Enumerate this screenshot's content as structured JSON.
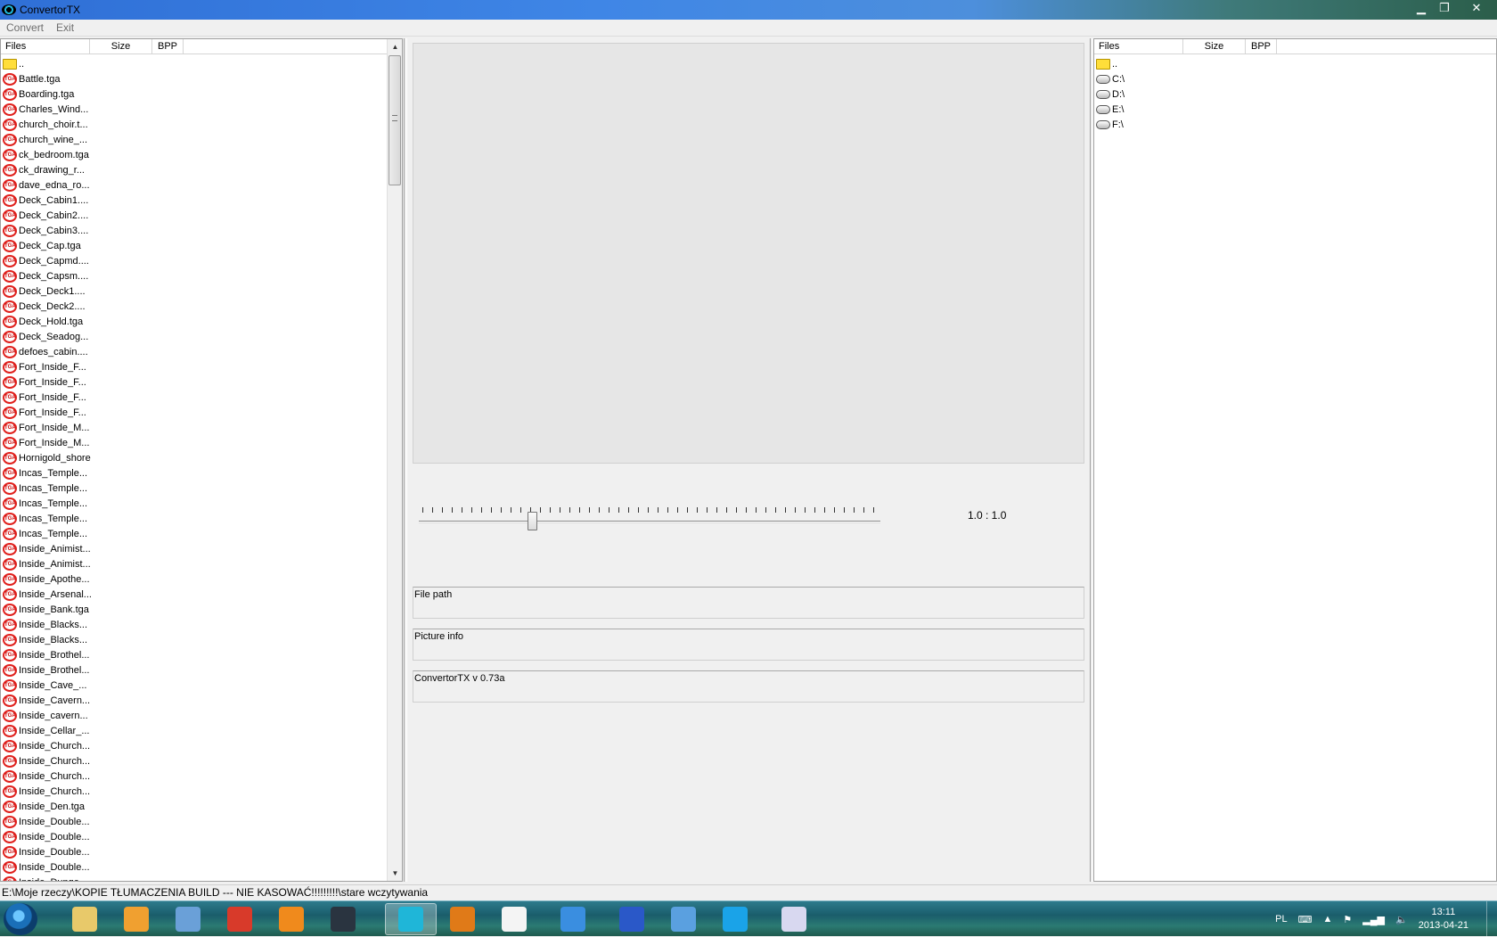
{
  "window": {
    "title": "ConvertorTX",
    "minimize": "▁",
    "restore": "❐",
    "close": "✕"
  },
  "menu": [
    {
      "label": "Convert"
    },
    {
      "label": "Exit"
    }
  ],
  "left_panel": {
    "columns": {
      "files": "Files",
      "size": "Size",
      "bpp": "BPP"
    },
    "items": [
      {
        "name": "..",
        "type": "folder"
      },
      {
        "name": "Battle.tga",
        "type": "tga"
      },
      {
        "name": "Boarding.tga",
        "type": "tga"
      },
      {
        "name": "Charles_Wind...",
        "type": "tga"
      },
      {
        "name": "church_choir.t...",
        "type": "tga"
      },
      {
        "name": "church_wine_...",
        "type": "tga"
      },
      {
        "name": "ck_bedroom.tga",
        "type": "tga"
      },
      {
        "name": "ck_drawing_r...",
        "type": "tga"
      },
      {
        "name": "dave_edna_ro...",
        "type": "tga"
      },
      {
        "name": "Deck_Cabin1....",
        "type": "tga"
      },
      {
        "name": "Deck_Cabin2....",
        "type": "tga"
      },
      {
        "name": "Deck_Cabin3....",
        "type": "tga"
      },
      {
        "name": "Deck_Cap.tga",
        "type": "tga"
      },
      {
        "name": "Deck_Capmd....",
        "type": "tga"
      },
      {
        "name": "Deck_Capsm....",
        "type": "tga"
      },
      {
        "name": "Deck_Deck1....",
        "type": "tga"
      },
      {
        "name": "Deck_Deck2....",
        "type": "tga"
      },
      {
        "name": "Deck_Hold.tga",
        "type": "tga"
      },
      {
        "name": "Deck_Seadog...",
        "type": "tga"
      },
      {
        "name": "defoes_cabin....",
        "type": "tga"
      },
      {
        "name": "Fort_Inside_F...",
        "type": "tga"
      },
      {
        "name": "Fort_Inside_F...",
        "type": "tga"
      },
      {
        "name": "Fort_Inside_F...",
        "type": "tga"
      },
      {
        "name": "Fort_Inside_F...",
        "type": "tga"
      },
      {
        "name": "Fort_Inside_M...",
        "type": "tga"
      },
      {
        "name": "Fort_Inside_M...",
        "type": "tga"
      },
      {
        "name": "Hornigold_shore",
        "type": "tga"
      },
      {
        "name": "Incas_Temple...",
        "type": "tga"
      },
      {
        "name": "Incas_Temple...",
        "type": "tga"
      },
      {
        "name": "Incas_Temple...",
        "type": "tga"
      },
      {
        "name": "Incas_Temple...",
        "type": "tga"
      },
      {
        "name": "Incas_Temple...",
        "type": "tga"
      },
      {
        "name": "Inside_Animist...",
        "type": "tga"
      },
      {
        "name": "Inside_Animist...",
        "type": "tga"
      },
      {
        "name": "Inside_Apothe...",
        "type": "tga"
      },
      {
        "name": "Inside_Arsenal...",
        "type": "tga"
      },
      {
        "name": "Inside_Bank.tga",
        "type": "tga"
      },
      {
        "name": "Inside_Blacks...",
        "type": "tga"
      },
      {
        "name": "Inside_Blacks...",
        "type": "tga"
      },
      {
        "name": "Inside_Brothel...",
        "type": "tga"
      },
      {
        "name": "Inside_Brothel...",
        "type": "tga"
      },
      {
        "name": "Inside_Cave_...",
        "type": "tga"
      },
      {
        "name": "Inside_Cavern...",
        "type": "tga"
      },
      {
        "name": "Inside_cavern...",
        "type": "tga"
      },
      {
        "name": "Inside_Cellar_...",
        "type": "tga"
      },
      {
        "name": "Inside_Church...",
        "type": "tga"
      },
      {
        "name": "Inside_Church...",
        "type": "tga"
      },
      {
        "name": "Inside_Church...",
        "type": "tga"
      },
      {
        "name": "Inside_Church...",
        "type": "tga"
      },
      {
        "name": "Inside_Den.tga",
        "type": "tga"
      },
      {
        "name": "Inside_Double...",
        "type": "tga"
      },
      {
        "name": "Inside_Double...",
        "type": "tga"
      },
      {
        "name": "Inside_Double...",
        "type": "tga"
      },
      {
        "name": "Inside_Double...",
        "type": "tga"
      },
      {
        "name": "Inside_Dunge...",
        "type": "tga"
      }
    ]
  },
  "right_panel": {
    "columns": {
      "files": "Files",
      "size": "Size",
      "bpp": "BPP"
    },
    "items": [
      {
        "name": "..",
        "type": "folder"
      },
      {
        "name": "C:\\",
        "type": "drive"
      },
      {
        "name": "D:\\",
        "type": "drive"
      },
      {
        "name": "E:\\",
        "type": "drive"
      },
      {
        "name": "F:\\",
        "type": "drive"
      }
    ]
  },
  "center": {
    "zoom_ratio": "1.0 : 1.0",
    "zoom_slider_fraction": 0.24,
    "file_path_label": "File path",
    "picture_info_label": "Picture info",
    "version_label": "ConvertorTX v 0.73a"
  },
  "status_bar": {
    "path": "E:\\Moje rzeczy\\KOPIE TŁUMACZENIA BUILD --- NIE KASOWAĆ!!!!!!!!!\\stare wczytywania"
  },
  "taskbar": {
    "buttons": [
      {
        "name": "explorer-icon",
        "color": "#e8c96a"
      },
      {
        "name": "media-player-icon",
        "color": "#f0a030"
      },
      {
        "name": "photos-icon",
        "color": "#6aa0d8"
      },
      {
        "name": "ccleaner-icon",
        "color": "#d83a2a"
      },
      {
        "name": "avast-icon",
        "color": "#f08a1c"
      },
      {
        "name": "steam-icon",
        "color": "#2a3440"
      },
      {
        "name": "convertortx-icon",
        "color": "#1fb6d8"
      },
      {
        "name": "winamp-icon",
        "color": "#e07a18"
      },
      {
        "name": "document-icon",
        "color": "#f4f4f4"
      },
      {
        "name": "internet-explorer-icon",
        "color": "#3a8ee0"
      },
      {
        "name": "buildings-icon",
        "color": "#2a58c8"
      },
      {
        "name": "computer-icon",
        "color": "#5aa0e0"
      },
      {
        "name": "skype-icon",
        "color": "#1aa3e8"
      },
      {
        "name": "paint-icon",
        "color": "#d8d8f0"
      }
    ],
    "language": "PL",
    "time": "13:11",
    "date": "2013-04-21"
  }
}
